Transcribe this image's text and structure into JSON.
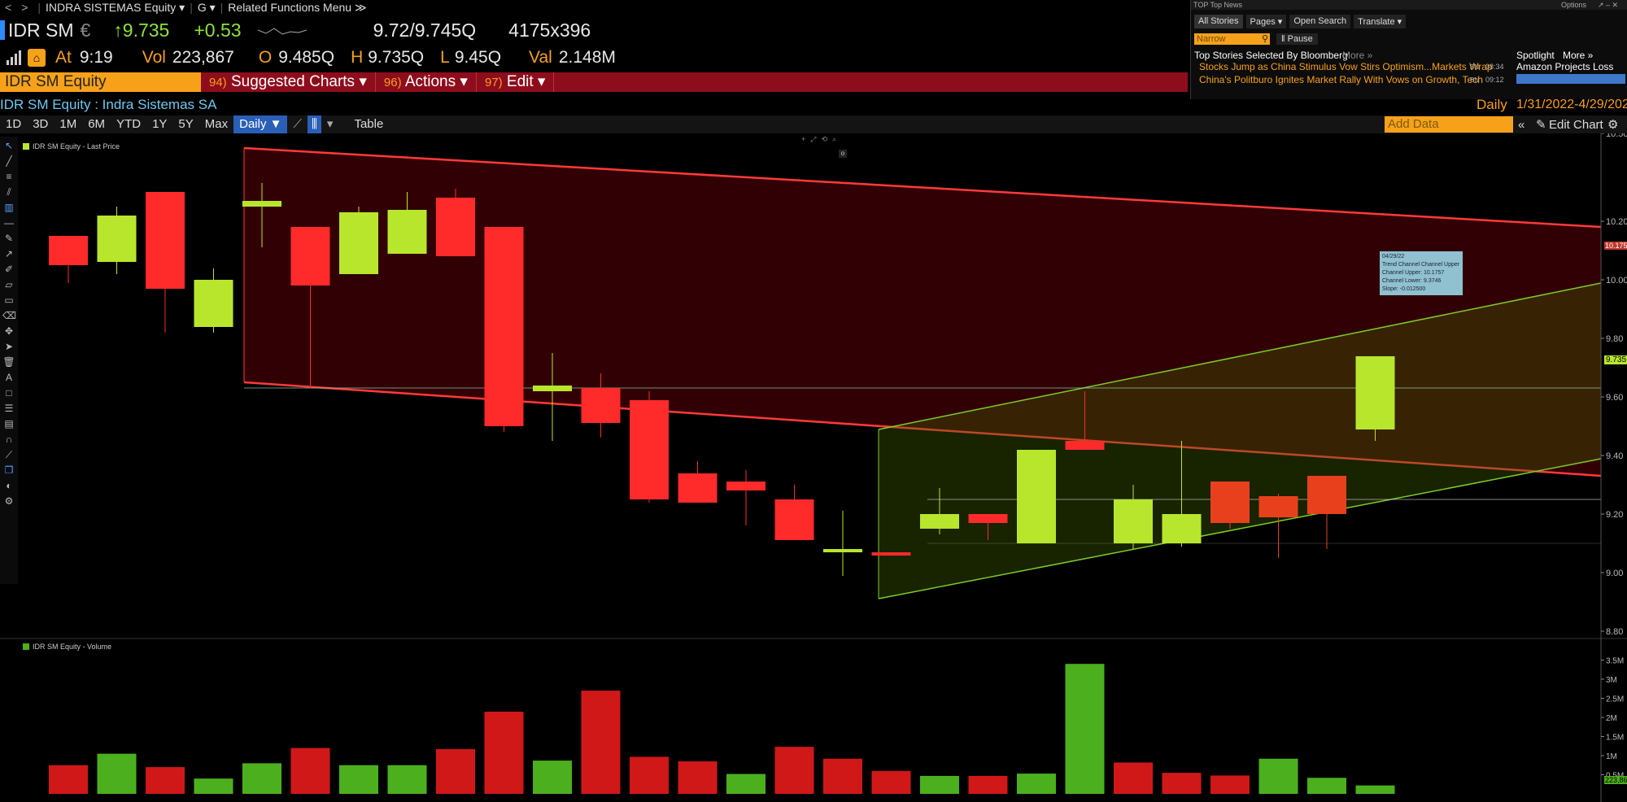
{
  "topbar": {
    "nav_back": "<",
    "nav_fwd": ">",
    "security_menu": "INDRA SISTEMAS Equity ▾",
    "g_menu": "G ▾",
    "related_menu": "Related Functions Menu ≫"
  },
  "quote": {
    "ticker": "IDR SM",
    "currency": "€",
    "arrow": "↑",
    "last": "9.735",
    "change": "+0.53",
    "bid_ask": "9.72/9.745Q",
    "size": "4175x396",
    "at_label": "At",
    "time": "9:19",
    "vol_label": "Vol",
    "volume": "223,867",
    "o_label": "O",
    "open": "9.485Q",
    "h_label": "H",
    "high": "9.735Q",
    "l_label": "L",
    "low": "9.45Q",
    "val_label": "Val",
    "value": "2.148M"
  },
  "menubar": {
    "ticker_box": "IDR SM Equity",
    "items": [
      {
        "num": "94)",
        "label": "Suggested Charts ▾"
      },
      {
        "num": "96)",
        "label": "Actions ▾"
      },
      {
        "num": "97)",
        "label": "Edit ▾"
      }
    ]
  },
  "security_line": {
    "name": "IDR SM Equity : Indra Sistemas SA",
    "frequency": "Daily",
    "date_range": "1/31/2022-4/29/2022"
  },
  "period_bar": {
    "periods": [
      "1D",
      "3D",
      "1M",
      "6M",
      "YTD",
      "1Y",
      "5Y",
      "Max"
    ],
    "frequency_button": "Daily ▼",
    "table_button": "Table",
    "add_data_placeholder": "Add Data",
    "edit_chart": "Edit Chart"
  },
  "news": {
    "title": "TOP Top News",
    "options": "Options",
    "tabs": [
      "All Stories",
      "Pages ▾",
      "Open Search",
      "Translate ▾"
    ],
    "narrow_placeholder": "Narrow",
    "pause": "Pause",
    "header": "Top Stories Selected By Bloomberg",
    "more": "More »",
    "spotlight": "Spotlight",
    "spotlight_more": "More »",
    "spotlight_item": "Amazon Projects Loss",
    "stories": [
      {
        "headline": "Stocks Jump as China Stimulus Vow Stirs Optimism...Markets Wrap",
        "src": "BN",
        "time": "08:34"
      },
      {
        "headline": "China's Politburo Ignites Market Rally With Vows on Growth, Tech",
        "src": "BN",
        "time": "09:12"
      }
    ]
  },
  "price_panel": {
    "legend": "IDR SM Equity - Last Price",
    "last_tag": "9.735",
    "upper_tag": "10.1757"
  },
  "volume_panel": {
    "legend": "IDR SM Equity - Volume",
    "last_tag": "223,867"
  },
  "tooltip": {
    "date": "04/29/22",
    "title": "Trend Channel Channel Upper",
    "upper": "Channel Upper: 10.1757",
    "lower": "Channel Lower: 9.3746",
    "slope": "Slope: -0.012500"
  },
  "colors": {
    "up": "#b8e62c",
    "down": "#ff2a2a",
    "down_recent": "#e8401c",
    "bg": "#000000",
    "accent": "#f7a11a",
    "menu": "#8e0d1c"
  },
  "chart_data": {
    "type": "candlestick",
    "title": "",
    "price_axis": {
      "min": 8.8,
      "max": 10.5,
      "ticks": [
        "8.80",
        "9.00",
        "9.20",
        "9.40",
        "9.60",
        "9.80",
        "10.00",
        "10.20",
        "10.50"
      ]
    },
    "volume_axis": {
      "min": 0,
      "max": 3.5,
      "ticks": [
        "0.5M",
        "1M",
        "1.5M",
        "2M",
        "2.5M",
        "3M",
        "3.5M"
      ]
    },
    "candles": [
      {
        "o": 10.05,
        "h": 10.12,
        "l": 9.99,
        "c": 10.15,
        "dir": "down",
        "h2": 10.15,
        "l2": 10.04
      },
      {
        "o": 10.06,
        "c": 10.22,
        "h": 10.25,
        "l": 10.02,
        "dir": "up"
      },
      {
        "o": 10.3,
        "c": 9.97,
        "h": 10.3,
        "l": 9.82,
        "dir": "down"
      },
      {
        "o": 9.84,
        "c": 10.0,
        "h": 10.04,
        "l": 9.82,
        "dir": "up"
      },
      {
        "o": 10.25,
        "c": 10.27,
        "h": 10.33,
        "l": 10.11,
        "dir": "up"
      },
      {
        "o": 10.18,
        "c": 9.98,
        "h": 10.18,
        "l": 9.63,
        "dir": "down"
      },
      {
        "o": 10.02,
        "c": 10.23,
        "h": 10.25,
        "l": 10.02,
        "dir": "up"
      },
      {
        "o": 10.09,
        "c": 10.24,
        "h": 10.3,
        "l": 10.09,
        "dir": "up"
      },
      {
        "o": 10.28,
        "c": 10.08,
        "h": 10.31,
        "l": 10.08,
        "dir": "down"
      },
      {
        "o": 10.18,
        "c": 9.5,
        "h": 10.18,
        "l": 9.48,
        "dir": "down"
      },
      {
        "o": 9.62,
        "c": 9.64,
        "h": 9.75,
        "l": 9.45,
        "dir": "up"
      },
      {
        "o": 9.63,
        "c": 9.51,
        "h": 9.68,
        "l": 9.46,
        "dir": "down"
      },
      {
        "o": 9.59,
        "c": 9.25,
        "h": 9.62,
        "l": 9.24,
        "dir": "down"
      },
      {
        "o": 9.34,
        "c": 9.24,
        "h": 9.38,
        "l": 9.24,
        "dir": "down"
      },
      {
        "o": 9.31,
        "c": 9.28,
        "h": 9.35,
        "l": 9.16,
        "dir": "down"
      },
      {
        "o": 9.25,
        "c": 9.11,
        "h": 9.3,
        "l": 9.11,
        "dir": "down"
      },
      {
        "o": 9.07,
        "c": 9.08,
        "h": 9.21,
        "l": 8.99,
        "dir": "up"
      },
      {
        "o": 9.07,
        "c": 9.06,
        "h": 9.07,
        "l": 9.06,
        "dir": "down"
      },
      {
        "o": 9.15,
        "c": 9.2,
        "h": 9.29,
        "l": 9.13,
        "dir": "up"
      },
      {
        "o": 9.2,
        "c": 9.17,
        "h": 9.2,
        "l": 9.11,
        "dir": "down"
      },
      {
        "o": 9.1,
        "c": 9.42,
        "h": 9.42,
        "l": 9.1,
        "dir": "up"
      },
      {
        "o": 9.45,
        "c": 9.42,
        "h": 9.62,
        "l": 9.42,
        "dir": "down"
      },
      {
        "o": 9.1,
        "c": 9.25,
        "h": 9.3,
        "l": 9.08,
        "dir": "up"
      },
      {
        "o": 9.1,
        "c": 9.2,
        "h": 9.45,
        "l": 9.09,
        "dir": "up"
      },
      {
        "o": 9.31,
        "c": 9.17,
        "h": 9.31,
        "l": 9.15,
        "dir": "down"
      },
      {
        "o": 9.26,
        "c": 9.19,
        "h": 9.27,
        "l": 9.05,
        "dir": "down"
      },
      {
        "o": 9.33,
        "c": 9.2,
        "h": 9.33,
        "l": 9.08,
        "dir": "down"
      },
      {
        "o": 9.49,
        "c": 9.74,
        "h": 9.74,
        "l": 9.45,
        "dir": "up"
      }
    ],
    "volumes": [
      {
        "v": 0.75,
        "dir": "down"
      },
      {
        "v": 1.05,
        "dir": "up"
      },
      {
        "v": 0.7,
        "dir": "down"
      },
      {
        "v": 0.4,
        "dir": "up"
      },
      {
        "v": 0.8,
        "dir": "up"
      },
      {
        "v": 1.2,
        "dir": "down"
      },
      {
        "v": 0.75,
        "dir": "up"
      },
      {
        "v": 0.75,
        "dir": "up"
      },
      {
        "v": 1.17,
        "dir": "down"
      },
      {
        "v": 2.15,
        "dir": "down"
      },
      {
        "v": 0.87,
        "dir": "up"
      },
      {
        "v": 2.7,
        "dir": "down"
      },
      {
        "v": 0.97,
        "dir": "down"
      },
      {
        "v": 0.85,
        "dir": "down"
      },
      {
        "v": 0.52,
        "dir": "up"
      },
      {
        "v": 1.23,
        "dir": "down"
      },
      {
        "v": 0.92,
        "dir": "down"
      },
      {
        "v": 0.6,
        "dir": "down"
      },
      {
        "v": 0.47,
        "dir": "up"
      },
      {
        "v": 0.47,
        "dir": "down"
      },
      {
        "v": 0.53,
        "dir": "up"
      },
      {
        "v": 3.4,
        "dir": "up"
      },
      {
        "v": 0.82,
        "dir": "down"
      },
      {
        "v": 0.55,
        "dir": "down"
      },
      {
        "v": 0.48,
        "dir": "down"
      },
      {
        "v": 0.92,
        "dir": "up"
      },
      {
        "v": 0.42,
        "dir": "up"
      },
      {
        "v": 0.22,
        "dir": "up"
      }
    ]
  }
}
